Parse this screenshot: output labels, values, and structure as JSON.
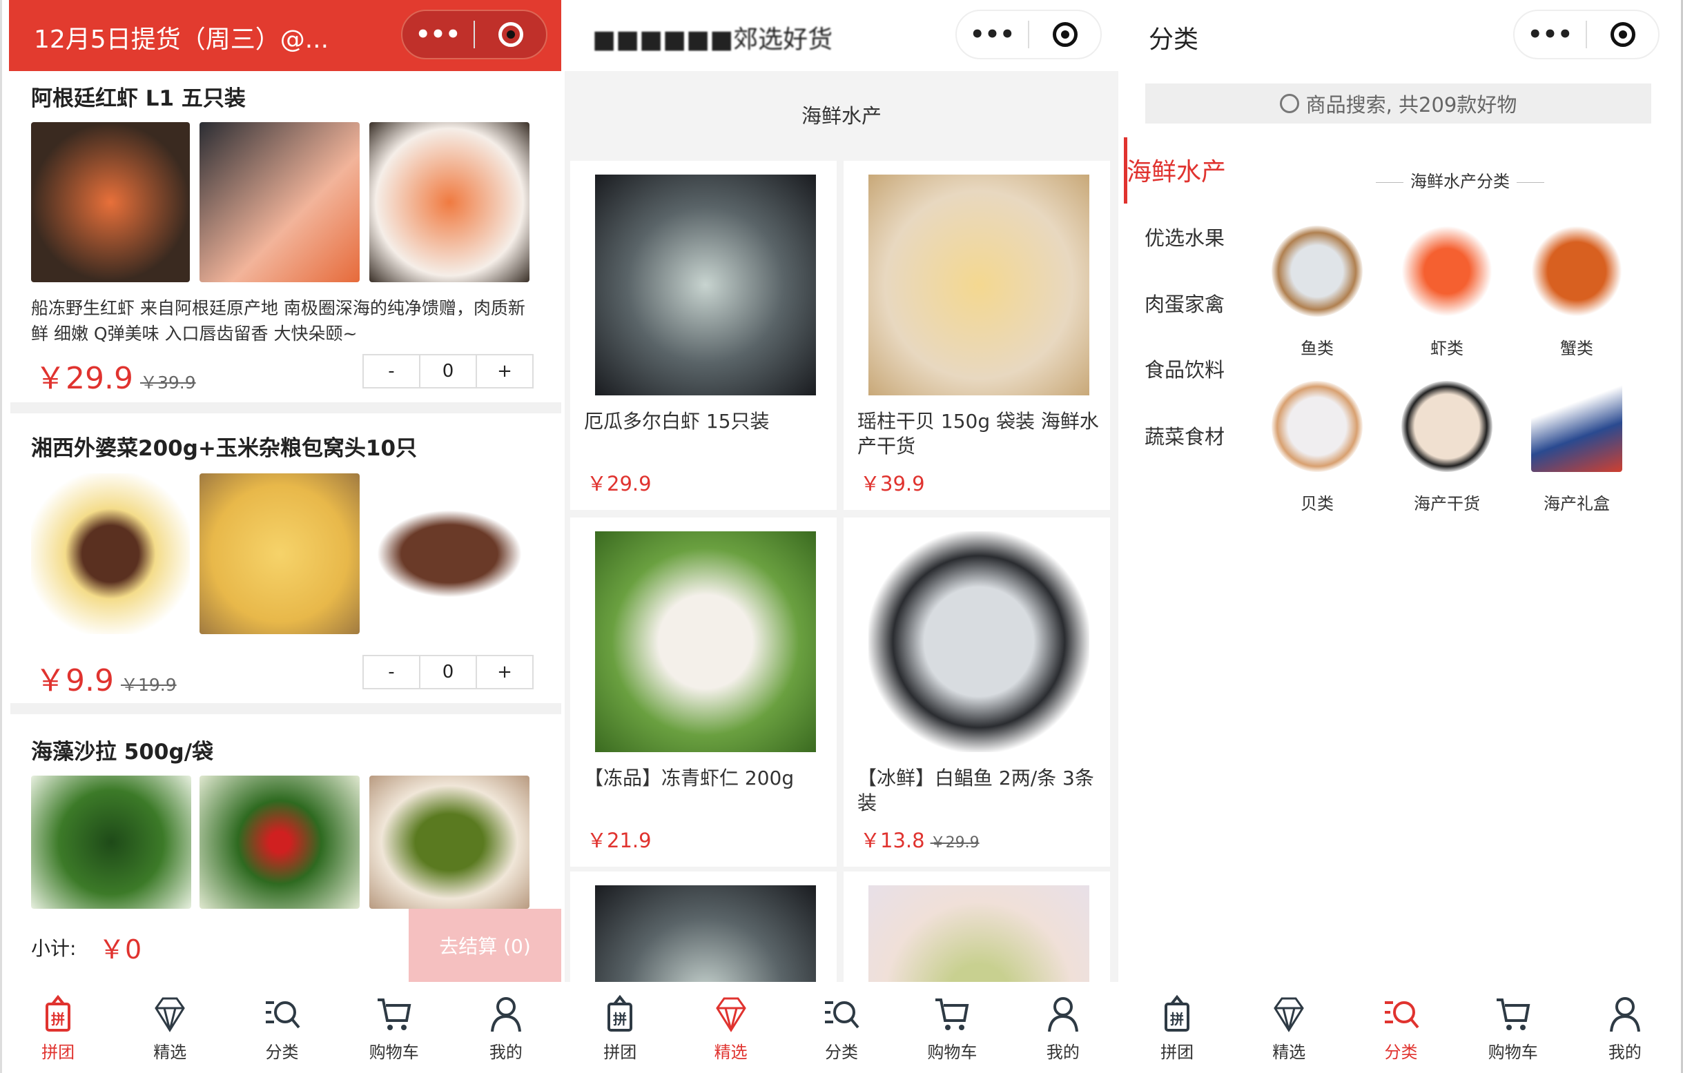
{
  "colors": {
    "accent": "#e0332f",
    "checkout_disabled": "#f5c0c0"
  },
  "panel1": {
    "header_title": "12月5日提货（周三）@...",
    "products": [
      {
        "title": "阿根廷红虾 L1 五只装",
        "desc": "船冻野生红虾 来自阿根廷原产地 南极圈深海的纯净馈赠，肉质新鲜 细嫩 Q弹美味 入口唇齿留香 大快朵颐~",
        "price": "￥29.9",
        "orig": "￥39.9",
        "qty": "0"
      },
      {
        "title": "湘西外婆菜200g+玉米杂粮包窝头10只",
        "desc": "",
        "price": "￥9.9",
        "orig": "￥19.9",
        "qty": "0"
      },
      {
        "title": "海藻沙拉 500g/袋"
      }
    ],
    "stepper": {
      "minus": "-",
      "plus": "+"
    },
    "subtotal_label": "小计:",
    "subtotal_value": "￥0",
    "checkout": "去结算 (0)"
  },
  "panel2": {
    "header_title": "■■■■■■郊选好货",
    "section": "海鲜水产",
    "cards": [
      {
        "name": "厄瓜多尔白虾 15只装",
        "price": "￥29.9",
        "orig": ""
      },
      {
        "name": "瑶柱干贝 150g 袋装 海鲜水产干货",
        "price": "￥39.9",
        "orig": ""
      },
      {
        "name": "【冻品】冻青虾仁 200g",
        "price": "￥21.9",
        "orig": ""
      },
      {
        "name": "【冰鲜】白鲳鱼 2两/条 3条装",
        "price": "￥13.8",
        "orig": "￥29.9"
      }
    ]
  },
  "panel3": {
    "header_title": "分类",
    "search_placeholder": "商品搜索, 共209款好物",
    "nav": [
      "海鲜水产",
      "优选水果",
      "肉蛋家禽",
      "食品饮料",
      "蔬菜食材"
    ],
    "section_title": "海鲜水产分类",
    "categories": [
      "鱼类",
      "虾类",
      "蟹类",
      "贝类",
      "海产干货",
      "海产礼盒"
    ]
  },
  "tabs": [
    {
      "label": "拼团",
      "icon": "group-buy-icon"
    },
    {
      "label": "精选",
      "icon": "diamond-icon"
    },
    {
      "label": "分类",
      "icon": "category-search-icon"
    },
    {
      "label": "购物车",
      "icon": "cart-icon"
    },
    {
      "label": "我的",
      "icon": "user-icon"
    }
  ],
  "active_tabs": [
    0,
    1,
    2
  ]
}
